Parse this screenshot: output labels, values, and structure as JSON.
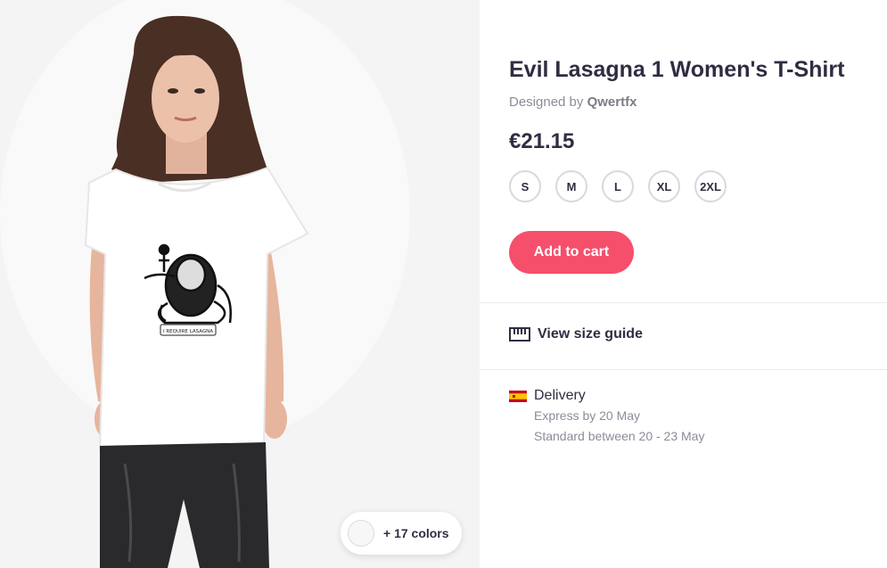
{
  "product": {
    "title": "Evil Lasagna 1 Women's T-Shirt",
    "designed_by_prefix": "Designed by",
    "designer": "Qwertfx",
    "price": "€21.15"
  },
  "sizes": [
    "S",
    "M",
    "L",
    "XL",
    "2XL"
  ],
  "actions": {
    "add_to_cart": "Add to cart",
    "size_guide": "View size guide"
  },
  "colors": {
    "more_label": "+ 17 colors"
  },
  "delivery": {
    "heading": "Delivery",
    "express": "Express by 20 May",
    "standard": "Standard between 20 - 23 May",
    "country_flag": "spain-flag"
  },
  "shirt_print_text": "I REQUIRE LASAGNA",
  "theme": {
    "accent": "#f64f6b",
    "text": "#302d42",
    "muted": "#8d8b99",
    "border": "#d8d8df"
  }
}
